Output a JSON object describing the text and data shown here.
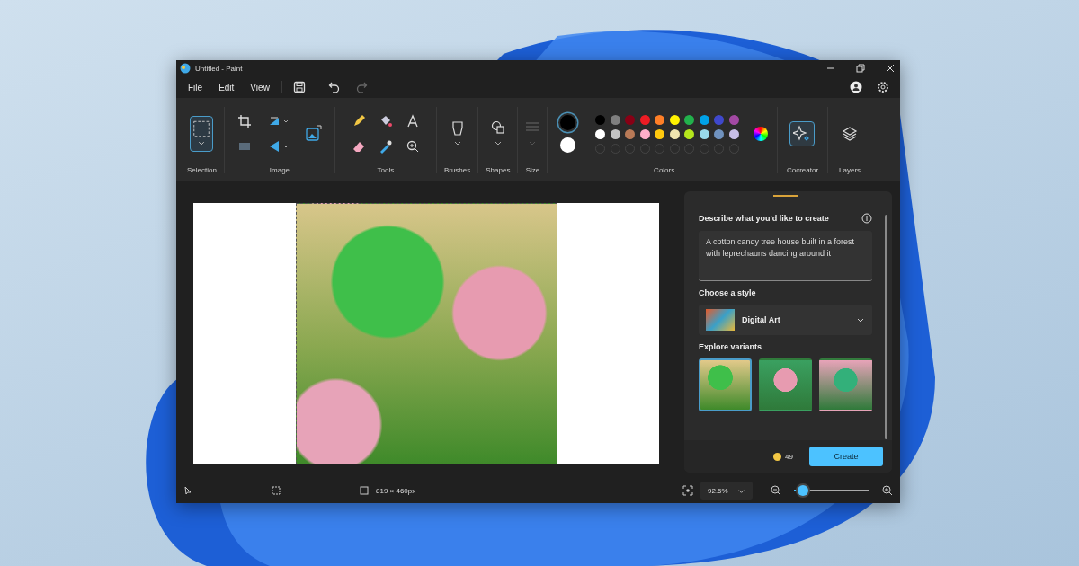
{
  "window": {
    "title": "Untitled - Paint"
  },
  "menu": [
    {
      "label": "File"
    },
    {
      "label": "Edit"
    },
    {
      "label": "View"
    }
  ],
  "ribbon": {
    "groups": [
      {
        "kind": "selection",
        "label": "Selection",
        "selected": true
      },
      {
        "kind": "image",
        "label": "Image"
      },
      {
        "kind": "tools",
        "label": "Tools"
      },
      {
        "kind": "brushes",
        "label": "Brushes"
      },
      {
        "kind": "shapes",
        "label": "Shapes"
      },
      {
        "kind": "size",
        "label": "Size",
        "disabled": true
      },
      {
        "kind": "colors",
        "label": "Colors"
      },
      {
        "kind": "cocreator",
        "label": "Cocreator",
        "selected": true
      },
      {
        "kind": "layers",
        "label": "Layers",
        "selected": false
      }
    ]
  },
  "colors": {
    "primary": {
      "color": "#000000",
      "selected": true
    },
    "secondary": {
      "color": "#ffffff",
      "selected": false
    },
    "palette": [
      {
        "color": "#000000"
      },
      {
        "color": "#7f7f7f"
      },
      {
        "color": "#880015"
      },
      {
        "color": "#ed1c24"
      },
      {
        "color": "#ff7f27"
      },
      {
        "color": "#fff200"
      },
      {
        "color": "#22b14c"
      },
      {
        "color": "#00a2e8"
      },
      {
        "color": "#3f48cc"
      },
      {
        "color": "#a349a4"
      },
      {
        "color": "#ffffff"
      },
      {
        "color": "#c3c3c3"
      },
      {
        "color": "#b97a57"
      },
      {
        "color": "#ffaec9"
      },
      {
        "color": "#ffc90e"
      },
      {
        "color": "#efe4b0"
      },
      {
        "color": "#b5e61d"
      },
      {
        "color": "#99d9ea"
      },
      {
        "color": "#7092be"
      },
      {
        "color": "#c8bfe7"
      }
    ]
  },
  "cocreator": {
    "prompt_label": "Describe what you'd like to create",
    "prompt": "A cotton candy tree house built in a forest with leprechauns dancing around it",
    "style_label": "Choose a style",
    "style": "Digital Art",
    "variants_label": "Explore variants",
    "variants": [
      {
        "selected": true
      },
      {
        "selected": false
      },
      {
        "selected": false
      }
    ],
    "credits": "49",
    "create_button": "Create"
  },
  "status_bar": {
    "canvas_size": "819 × 460px",
    "zoom": "92.5%",
    "zoom_slider": {
      "level": 0.12
    }
  }
}
